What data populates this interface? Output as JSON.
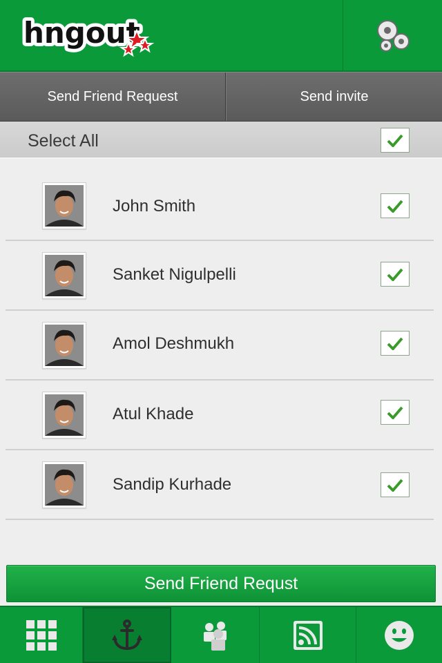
{
  "header": {
    "logo_text": "hngout",
    "settings_icon": "gear-icon"
  },
  "tabs": [
    {
      "label": "Send Friend Request"
    },
    {
      "label": "Send invite"
    }
  ],
  "select_all": {
    "label": "Select All",
    "checked": true
  },
  "contacts": [
    {
      "name": "John Smith",
      "checked": true
    },
    {
      "name": "Sanket Nigulpelli",
      "checked": true
    },
    {
      "name": "Amol Deshmukh",
      "checked": true
    },
    {
      "name": "Atul Khade",
      "checked": true
    },
    {
      "name": "Sandip Kurhade",
      "checked": true
    }
  ],
  "action": {
    "send_label": "Send Friend Requst"
  },
  "bottom_nav": [
    {
      "icon": "grid-icon",
      "active": false
    },
    {
      "icon": "anchor-icon",
      "active": true
    },
    {
      "icon": "people-icon",
      "active": false
    },
    {
      "icon": "rss-feed-icon",
      "active": false
    },
    {
      "icon": "smiley-icon",
      "active": false
    }
  ],
  "colors": {
    "brand_green": "#0b9a3a",
    "check_green": "#3a9a2a",
    "logo_star_red": "#e01b24"
  }
}
